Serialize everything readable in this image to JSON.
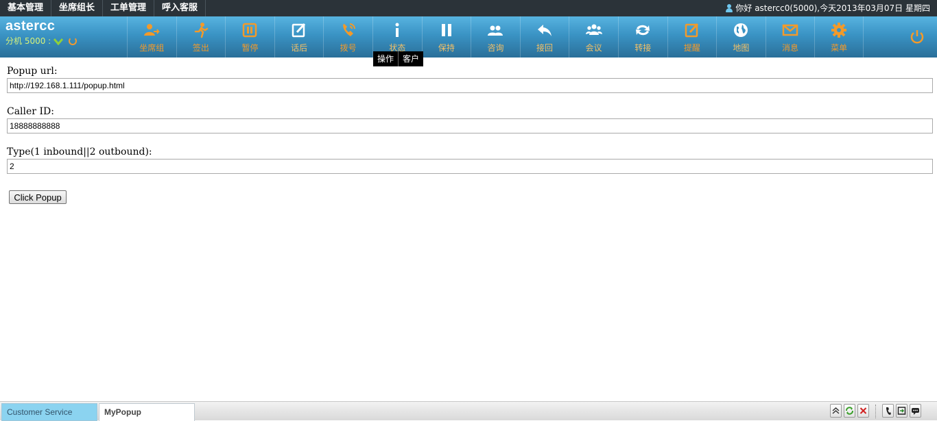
{
  "topmenu": {
    "items": [
      "基本管理",
      "坐席组长",
      "工单管理",
      "呼入客服"
    ],
    "greeting": "你好 astercc0(5000),今天2013年03月07日 星期四"
  },
  "brand": {
    "name": "astercc",
    "extension": "分机 5000 :"
  },
  "toolbar": {
    "items": [
      {
        "label": "坐席组",
        "icon": "agent-group-icon"
      },
      {
        "label": "签出",
        "icon": "sign-out-icon"
      },
      {
        "label": "暂停",
        "icon": "pause-square-icon"
      },
      {
        "label": "话后",
        "icon": "after-call-icon"
      },
      {
        "label": "拨号",
        "icon": "dial-icon"
      },
      {
        "label": "状态",
        "icon": "info-icon"
      },
      {
        "label": "保持",
        "icon": "hold-icon"
      },
      {
        "label": "咨询",
        "icon": "consult-icon"
      },
      {
        "label": "接回",
        "icon": "retrieve-icon"
      },
      {
        "label": "会议",
        "icon": "conference-icon"
      },
      {
        "label": "转接",
        "icon": "transfer-icon"
      },
      {
        "label": "提醒",
        "icon": "reminder-icon"
      },
      {
        "label": "地图",
        "icon": "globe-icon"
      },
      {
        "label": "消息",
        "icon": "message-icon"
      },
      {
        "label": "菜单",
        "icon": "gear-icon"
      }
    ],
    "tooltip": [
      "操作",
      "客户"
    ]
  },
  "form": {
    "popup_url_label": "Popup url:",
    "popup_url_value": "http://192.168.1.111/popup.html",
    "caller_id_label": "Caller ID:",
    "caller_id_value": "18888888888",
    "type_label": "Type(1 inbound||2 outbound):",
    "type_value": "2",
    "button_label": "Click Popup"
  },
  "taskbar": {
    "tabs": [
      "Customer Service",
      "MyPopup"
    ]
  },
  "colors": {
    "topbar": "#2b3339",
    "toolbar_top": "#57b3e0",
    "toolbar_bottom": "#2a6f99",
    "icon_orange": "#f39a2a",
    "extension_green": "#d7f27a"
  }
}
